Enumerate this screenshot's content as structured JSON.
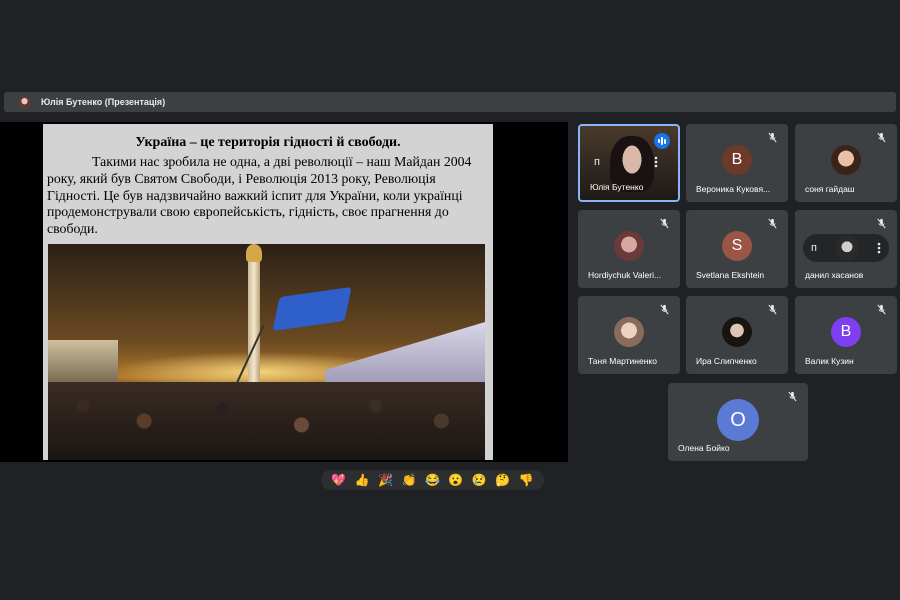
{
  "presenter": {
    "label": "Юлія Бутенко (Презентація)"
  },
  "slide": {
    "title": "Україна – це територія гідності й свободи.",
    "body": "Такими нас зробила не одна, а дві революції – наш Майдан 2004 року, який був Святом Свободи, і Революція 2013 року, Революція Гідності. Це був надзвичайно важкий іспит для України, коли українці продемонстрували свою європейськість, гідність, своє прагнення до свободи."
  },
  "participants": [
    {
      "name": "Юлія Бутенко",
      "avatar": "video",
      "speaking": true
    },
    {
      "name": "Вероника Куковя...",
      "initial": "В",
      "color": "#6d3a2a"
    },
    {
      "name": "соня гайдаш",
      "avatar": "photo"
    },
    {
      "name": "Hordiychuk Valeri...",
      "avatar": "photo"
    },
    {
      "name": "Svetlana Ekshtein",
      "initial": "S",
      "color": "#9a5545"
    },
    {
      "name": "данил хасанов",
      "avatar": "photo",
      "pin_label": "п"
    },
    {
      "name": "Таня Мартиненко",
      "avatar": "photo"
    },
    {
      "name": "Ира Слипченко",
      "avatar": "photo"
    },
    {
      "name": "Валик Кузин",
      "initial": "В",
      "color": "#7e3ff2"
    },
    {
      "name": "Олена Бойко",
      "initial": "О",
      "color": "#5b7ad6"
    }
  ],
  "self_controls": {
    "pin_label": "п"
  },
  "reactions": [
    "💖",
    "👍",
    "🎉",
    "👏",
    "😂",
    "😮",
    "😢",
    "🤔",
    "👎"
  ]
}
